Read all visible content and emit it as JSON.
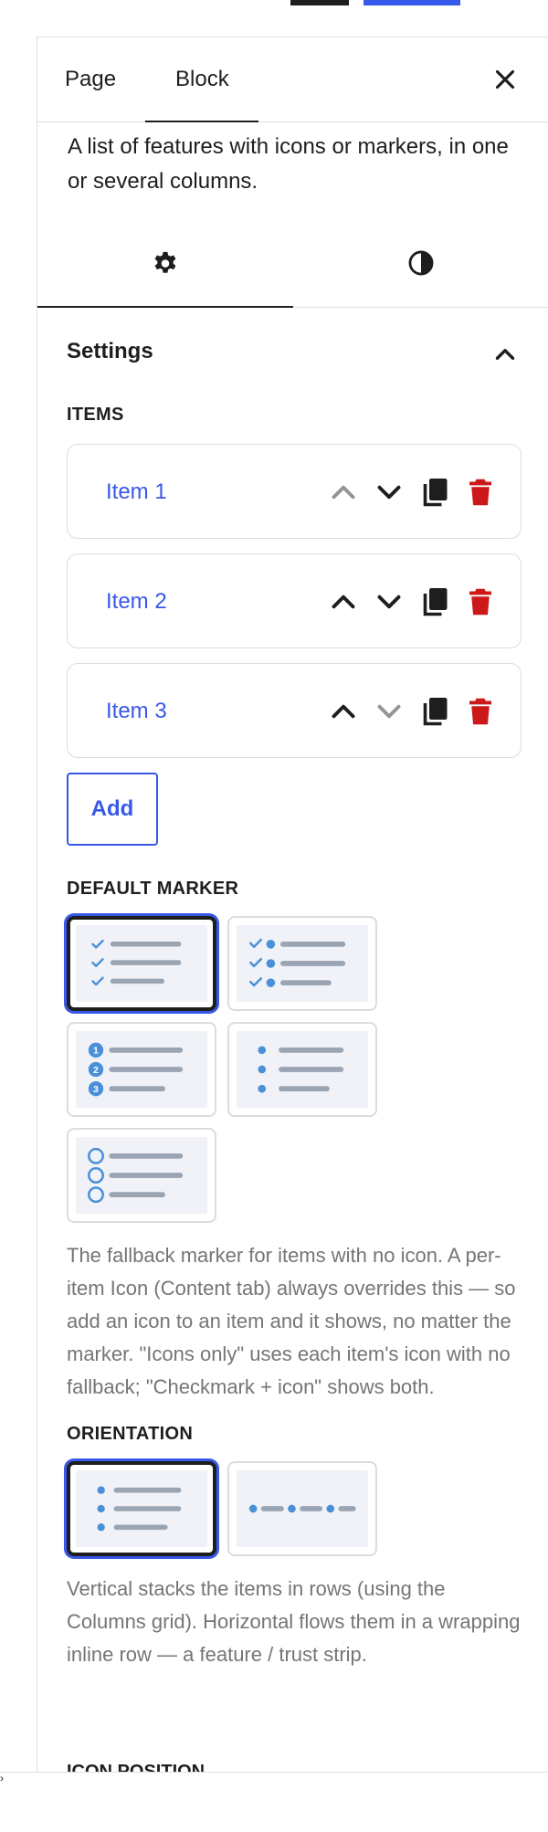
{
  "tabs": {
    "page": "Page",
    "block": "Block"
  },
  "block_description": "A list of features with icons or markers, in one or several columns.",
  "subtabs": {
    "settings_icon": "gear-icon",
    "styles_icon": "contrast-icon"
  },
  "settings": {
    "title": "Settings",
    "items_label": "ITEMS",
    "items": [
      {
        "label": "Item 1",
        "up_enabled": false,
        "down_enabled": true
      },
      {
        "label": "Item 2",
        "up_enabled": true,
        "down_enabled": true
      },
      {
        "label": "Item 3",
        "up_enabled": true,
        "down_enabled": false
      }
    ],
    "add_label": "Add",
    "default_marker_label": "DEFAULT MARKER",
    "marker_options": [
      "checkmark",
      "checkmark-icon",
      "numbers",
      "dots",
      "icons-only"
    ],
    "marker_selected": "checkmark",
    "marker_help": "The fallback marker for items with no icon. A per-item Icon (Content tab) always overrides this — so add an icon to an item and it shows, no matter the marker. \"Icons only\" uses each item's icon with no fallback; \"Checkmark + icon\" shows both.",
    "orientation_label": "ORIENTATION",
    "orientation_options": [
      "vertical",
      "horizontal"
    ],
    "orientation_selected": "vertical",
    "orientation_help": "Vertical stacks the items in rows (using the Columns grid). Horizontal flows them in a wrapping inline row — a feature / trust strip.",
    "next_label": "ICON POSITION"
  },
  "colors": {
    "accent": "#3858e9",
    "marker_blue": "#4a90d9",
    "line_gray": "#9aa5b4",
    "delete_red": "#cc1818",
    "disabled_gray": "#949494"
  }
}
